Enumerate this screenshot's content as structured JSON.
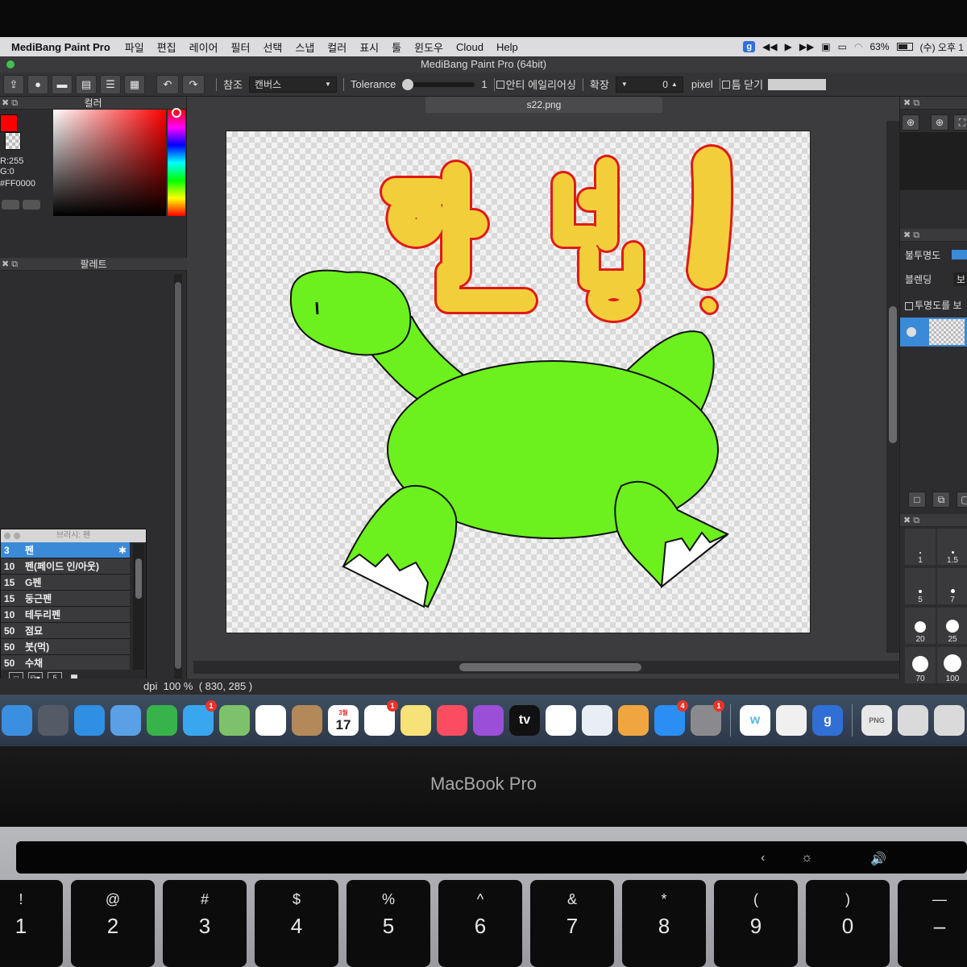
{
  "menubar": {
    "app_name": "MediBang Paint Pro",
    "items": [
      "파일",
      "편집",
      "레이어",
      "필터",
      "선택",
      "스냅",
      "컬러",
      "표시",
      "툴",
      "윈도우",
      "Cloud",
      "Help"
    ],
    "status_icons": [
      "g-extension-icon",
      "rewind-icon",
      "play-icon",
      "fast-forward-icon",
      "screen-mirroring-icon",
      "display-icon",
      "wifi-icon"
    ],
    "extension_letter": "g",
    "battery": "63%",
    "clock": "(수) 오후 1"
  },
  "window": {
    "title": "MediBang Paint Pro (64bit)"
  },
  "toolbar": {
    "undo_icon": "↶",
    "redo_icon": "↷",
    "reference_label": "참조",
    "reference_value": "캔버스",
    "tolerance_label": "Tolerance",
    "tolerance_value": "1",
    "tolerance_level": 0.02,
    "antialias_label": "안티 에일리어싱",
    "expand_label": "확장",
    "expand_value": "0",
    "expand_unit": "pixel",
    "close_gap_label": "틈 닫기"
  },
  "color_panel": {
    "title": "컬러",
    "primary_color": "#ff0000",
    "rgb_line1": "R:255",
    "rgb_line2": "G:0",
    "hex_value": "#FF0000"
  },
  "palette_panel": {
    "title": "팔레트"
  },
  "brush_panel": {
    "title": "브러시: 펜",
    "items": [
      {
        "size": "3",
        "name": "펜",
        "selected": true
      },
      {
        "size": "10",
        "name": "펜(페이드 인/아웃)",
        "selected": false
      },
      {
        "size": "15",
        "name": "G펜",
        "selected": false
      },
      {
        "size": "15",
        "name": "둥근펜",
        "selected": false
      },
      {
        "size": "10",
        "name": "테두리펜",
        "selected": false
      },
      {
        "size": "50",
        "name": "점묘",
        "selected": false
      },
      {
        "size": "50",
        "name": "붓(먹)",
        "selected": false
      },
      {
        "size": "50",
        "name": "수채",
        "selected": false
      }
    ]
  },
  "canvas": {
    "tab_name": "s22.png",
    "artwork_text": "안녕!",
    "text_fill": "#f2cf3a",
    "text_outline": "#e01a1a",
    "dino_fill": "#6cf01e",
    "dino_outline": "#111111"
  },
  "statusbar": {
    "dpi": "dpi",
    "zoom": "100 %",
    "coords": "( 830, 285 )"
  },
  "right_panel": {
    "opacity_label": "불투명도",
    "blending_label": "블렌딩",
    "blending_value": "보",
    "protect_alpha_label": "투명도를 보",
    "brush_sizes": [
      "1",
      "1.5",
      "5",
      "7",
      "20",
      "25",
      "70",
      "100"
    ]
  },
  "dock": {
    "apps": [
      {
        "name": "finder",
        "badge": ""
      },
      {
        "name": "launchpad",
        "badge": ""
      },
      {
        "name": "safari",
        "badge": ""
      },
      {
        "name": "mail",
        "badge": ""
      },
      {
        "name": "facetime",
        "badge": ""
      },
      {
        "name": "messages",
        "badge": "1"
      },
      {
        "name": "maps",
        "badge": ""
      },
      {
        "name": "photos",
        "badge": ""
      },
      {
        "name": "contacts",
        "badge": ""
      },
      {
        "name": "calendar",
        "badge": "",
        "month": "3월",
        "day": "17"
      },
      {
        "name": "reminders",
        "badge": "1"
      },
      {
        "name": "notes",
        "badge": ""
      },
      {
        "name": "music",
        "badge": ""
      },
      {
        "name": "podcasts",
        "badge": ""
      },
      {
        "name": "apple-tv",
        "badge": "",
        "label": "tv"
      },
      {
        "name": "numbers",
        "badge": ""
      },
      {
        "name": "keynote",
        "badge": ""
      },
      {
        "name": "pages",
        "badge": ""
      },
      {
        "name": "app-store",
        "badge": "4"
      },
      {
        "name": "system-preferences",
        "badge": "1"
      },
      {
        "name": "w-app",
        "badge": "",
        "label": "w"
      },
      {
        "name": "color-app",
        "badge": ""
      },
      {
        "name": "g-app",
        "badge": "",
        "label": "g"
      },
      {
        "name": "png-file",
        "badge": "",
        "label": "PNG"
      },
      {
        "name": "screenshot-folder",
        "badge": ""
      },
      {
        "name": "preview-window",
        "badge": ""
      }
    ]
  },
  "laptop": {
    "brand": "MacBook Pro",
    "keys": [
      {
        "top": "!",
        "bottom": "1"
      },
      {
        "top": "@",
        "bottom": "2"
      },
      {
        "top": "#",
        "bottom": "3"
      },
      {
        "top": "$",
        "bottom": "4"
      },
      {
        "top": "%",
        "bottom": "5"
      },
      {
        "top": "^",
        "bottom": "6"
      },
      {
        "top": "&",
        "bottom": "7"
      },
      {
        "top": "*",
        "bottom": "8"
      },
      {
        "top": "(",
        "bottom": "9"
      },
      {
        "top": ")",
        "bottom": "0"
      },
      {
        "top": "—",
        "bottom": "–"
      }
    ],
    "touchbar_icons": [
      "‹",
      "☼",
      "🔊"
    ]
  }
}
